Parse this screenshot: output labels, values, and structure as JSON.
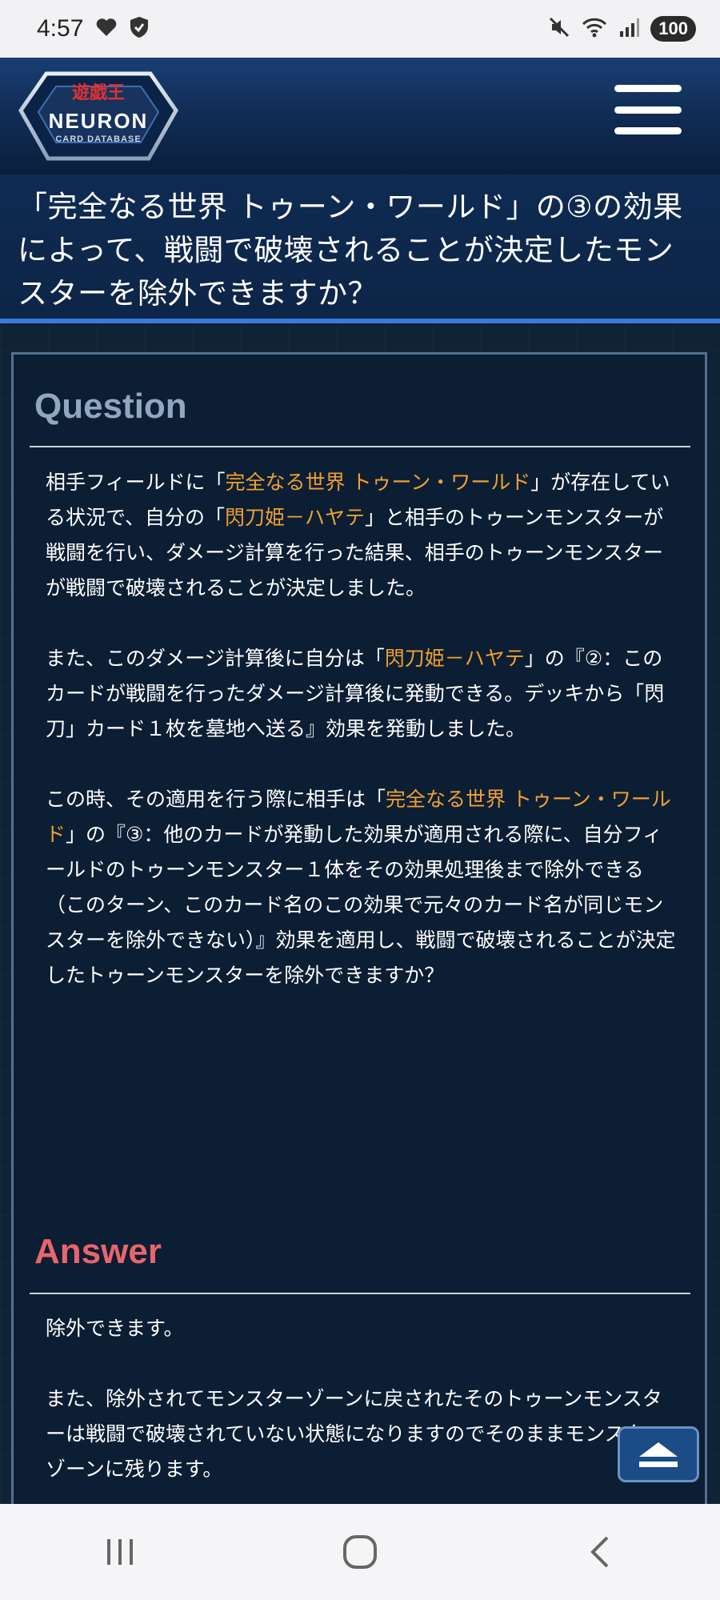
{
  "status_bar": {
    "time": "4:57",
    "battery": "100"
  },
  "header": {
    "logo_text_line1": "遊戯王",
    "logo_text_line2": "NEURON",
    "logo_text_line3": "CARD DATABASE"
  },
  "page_title": "「完全なる世界 トゥーン・ワールド」の③の効果によって、戦闘で破壊されることが決定したモンスターを除外できますか？",
  "question": {
    "heading": "Question",
    "p1": {
      "t1": "相手フィールドに「",
      "link1": "完全なる世界 トゥーン・ワールド",
      "t2": "」が存在している状況で、自分の「",
      "link2": "閃刀姫－ハヤテ",
      "t3": "」と相手のトゥーンモンスターが戦闘を行い、ダメージ計算を行った結果、相手のトゥーンモンスターが戦闘で破壊されることが決定しました。"
    },
    "p2": {
      "t1": "また、このダメージ計算後に自分は「",
      "link1": "閃刀姫－ハヤテ",
      "t2": "」の『②：このカードが戦闘を行ったダメージ計算後に発動できる。デッキから「閃刀」カード１枚を墓地へ送る』効果を発動しました。"
    },
    "p3": {
      "t1": "この時、その適用を行う際に相手は「",
      "link1": "完全なる世界 トゥーン・ワールド",
      "t2": "」の『③：他のカードが発動した効果が適用される際に、自分フィールドのトゥーンモンスター１体をその効果処理後まで除外できる（このターン、このカード名のこの効果で元々のカード名が同じモンスターを除外できない）』効果を適用し、戦闘で破壊されることが決定したトゥーンモンスターを除外できますか？"
    }
  },
  "answer": {
    "heading": "Answer",
    "p1": "除外できます。",
    "p2": "また、除外されてモンスターゾーンに戻されたそのトゥーンモンスターは戦闘で破壊されていない状態になりますのでそのままモンスターゾーンに残ります。"
  },
  "colors": {
    "header_bg": "#1a3e73",
    "panel_bg": "#0c1e33",
    "question_heading": "#8fa7bf",
    "answer_heading": "#e8656c",
    "card_link": "#f0a030"
  }
}
